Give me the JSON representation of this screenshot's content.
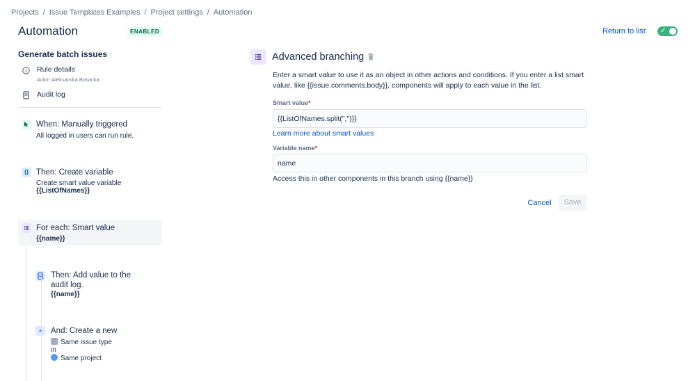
{
  "breadcrumb": {
    "items": [
      "Projects",
      "Issue Templates Examples",
      "Project settings",
      "Automation"
    ],
    "separator": "/"
  },
  "header": {
    "title": "Automation",
    "status": "ENABLED",
    "return_label": "Return to list",
    "toggle_on": true
  },
  "sidebar": {
    "rule_name": "Generate batch issues",
    "rule_details": {
      "label": "Rule details",
      "sub": "Actor: Aleksandra Bosacka"
    },
    "audit_log": {
      "label": "Audit log"
    }
  },
  "steps": {
    "trigger": {
      "title": "When: Manually triggered",
      "line": "All logged in users can run rule."
    },
    "variable": {
      "title": "Then: Create variable",
      "line": "Create smart value variable",
      "bold": "{{ListOfNames}}"
    },
    "branch": {
      "title": "For each: Smart value",
      "bold": "{{name}}"
    },
    "audit": {
      "title_1": "Then: Add value to the",
      "title_2": "audit log.",
      "bold": "{{name}}"
    },
    "create": {
      "title": "And: Create a new",
      "line_1": "Same issue type",
      "line_2": "in",
      "line_3": "Same project"
    }
  },
  "panel": {
    "title": "Advanced branching",
    "description": "Enter a smart value to use it as an object in other actions and conditions. If you enter a list smart value, like {{issue.comments.body}}, components will apply to each value in the list.",
    "smart_value_label": "Smart value",
    "smart_value": "{{ListOfNames.split(\",\")}}",
    "learn_more": "Learn more about smart values",
    "variable_name_label": "Variable name",
    "variable_name": "name",
    "help": "Access this in other components in this branch using {{name}}",
    "required_mark": "*",
    "cancel_label": "Cancel",
    "save_label": "Save"
  },
  "colors": {
    "accent": "#0052cc",
    "enabled": "#36b37e",
    "text": "#172b4d"
  }
}
